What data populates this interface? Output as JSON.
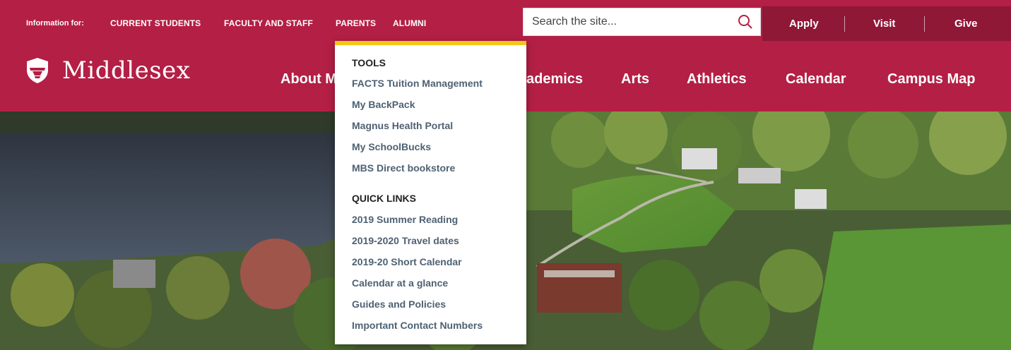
{
  "utility": {
    "info_label": "Information for:",
    "links": [
      "CURRENT STUDENTS",
      "FACULTY AND STAFF",
      "PARENTS",
      "ALUMNI"
    ],
    "search_placeholder": "Search the site...",
    "actions": [
      "Apply",
      "Visit",
      "Give"
    ]
  },
  "brand": {
    "name": "Middlesex"
  },
  "nav": {
    "items": [
      "About M",
      "ademics",
      "Arts",
      "Athletics",
      "Calendar",
      "Campus Map"
    ]
  },
  "dropdown": {
    "tools_heading": "TOOLS",
    "tools": [
      "FACTS Tuition Management",
      "My BackPack",
      "Magnus Health Portal",
      "My SchoolBucks",
      "MBS Direct bookstore"
    ],
    "quick_heading": "QUICK LINKS",
    "quick_links": [
      "2019 Summer Reading",
      "2019-2020 Travel dates",
      "2019-20 Short Calendar",
      "Calendar at a glance",
      "Guides and Policies",
      "Important Contact Numbers"
    ]
  },
  "colors": {
    "brand": "#b41f45",
    "brand_dark": "#8e1836",
    "accent": "#f5c518",
    "link": "#4e6173"
  },
  "icons": {
    "search": "search-icon",
    "logo": "shield-icon"
  }
}
